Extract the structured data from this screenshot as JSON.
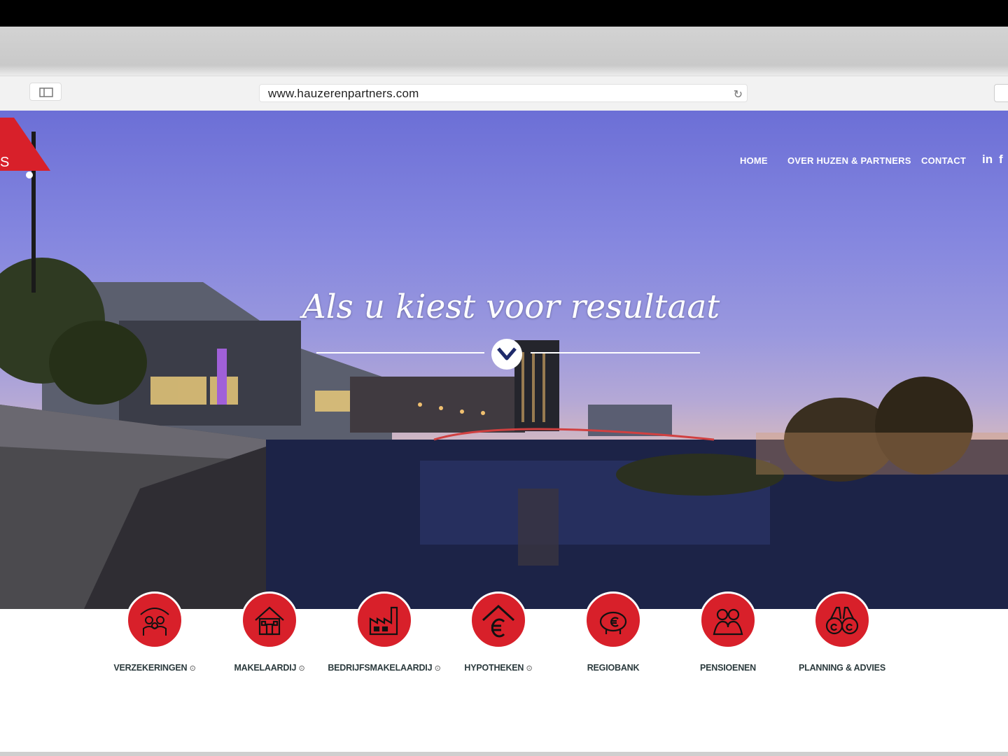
{
  "browser": {
    "url": "www.hauzerenpartners.com"
  },
  "nav": {
    "home": "HOME",
    "over": "OVER HUZEN & PARTNERS",
    "contact": "CONTACT",
    "linkedin": "in",
    "facebook": "f"
  },
  "hero": {
    "headline": "Als u kiest voor resultaat"
  },
  "services": [
    {
      "label": "VERZEKERINGEN",
      "arrow": "⊙",
      "icon": "family-umbrella-icon"
    },
    {
      "label": "MAKELAARDIJ",
      "arrow": "⊙",
      "icon": "house-icon"
    },
    {
      "label": "BEDRIJFSMAKELAARDIJ",
      "arrow": "⊙",
      "icon": "factory-icon"
    },
    {
      "label": "HYPOTHEKEN",
      "arrow": "⊙",
      "icon": "house-euro-icon"
    },
    {
      "label": "REGIOBANK",
      "arrow": "",
      "icon": "piggy-bank-icon"
    },
    {
      "label": "PENSIOENEN",
      "arrow": "",
      "icon": "couple-icon"
    },
    {
      "label": "PLANNING & ADVIES",
      "arrow": "",
      "icon": "binoculars-icon"
    }
  ],
  "colors": {
    "brand_red": "#d8202a",
    "label_text": "#2b3a3d"
  }
}
